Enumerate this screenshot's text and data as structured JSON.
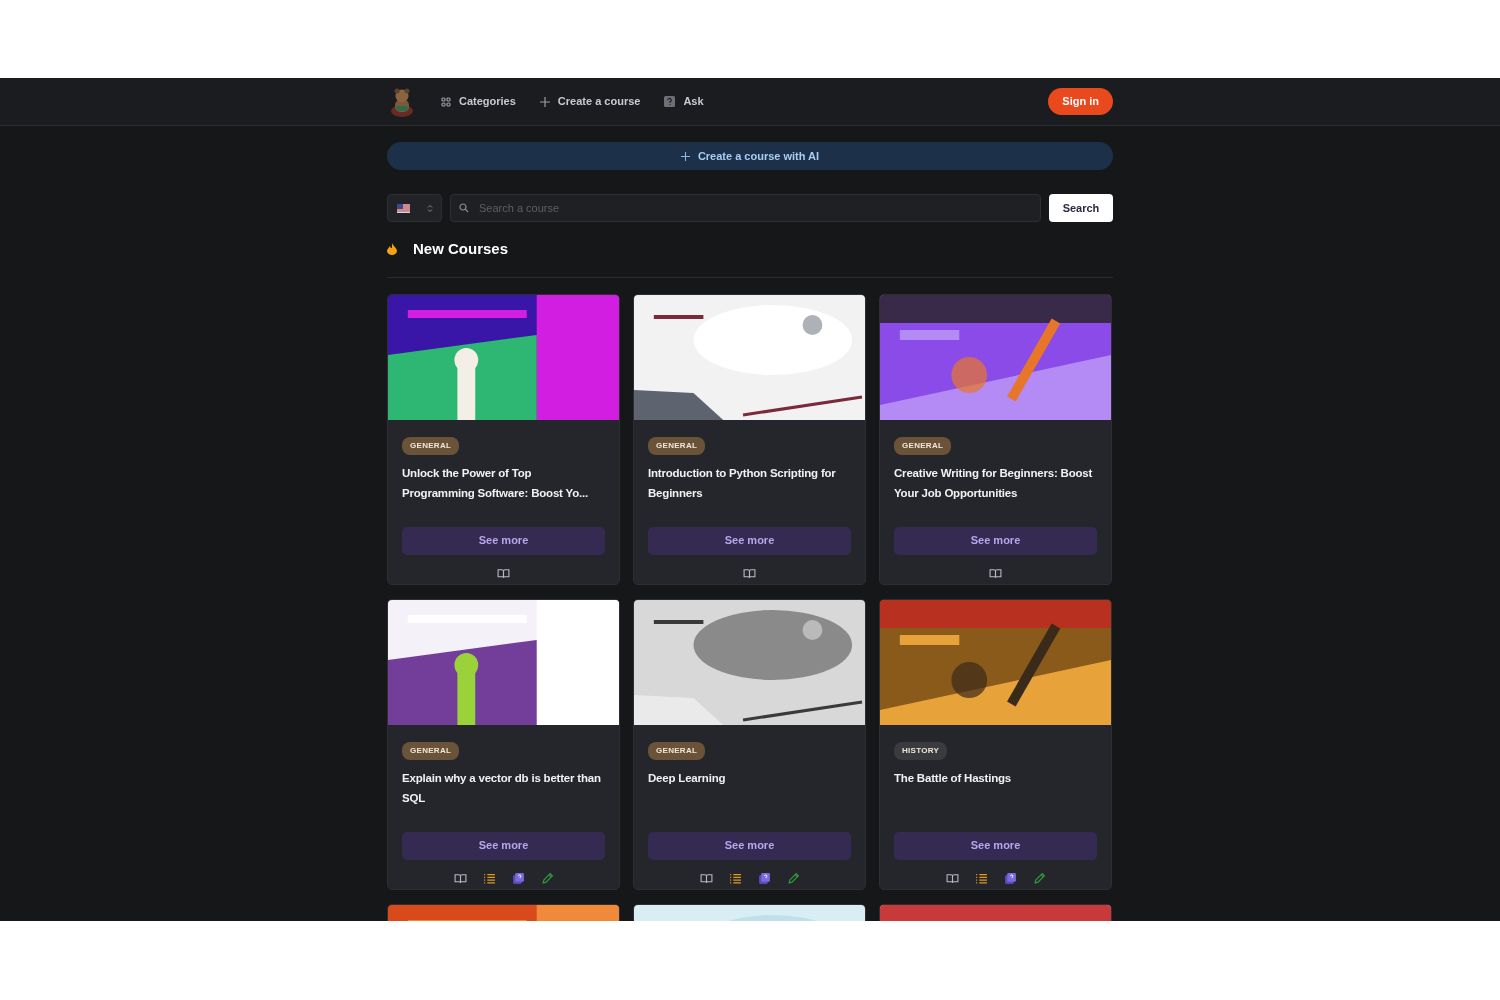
{
  "navbar": {
    "links": [
      {
        "kind": "categories",
        "label": "Categories"
      },
      {
        "kind": "create",
        "label": "Create a course"
      },
      {
        "kind": "ask",
        "label": "Ask"
      }
    ],
    "sign_in": "Sign in"
  },
  "ai_button": "Create a course with AI",
  "search": {
    "placeholder": "Search a course",
    "button": "Search"
  },
  "section_title": "New Courses",
  "cards": [
    {
      "category": "GENERAL",
      "color": "#6b5339",
      "title": "Unlock the Power of Top Programming Software: Boost Yo...",
      "button": "See more",
      "tools": [
        {
          "kind": "read"
        }
      ]
    },
    {
      "category": "GENERAL",
      "color": "#6b5339",
      "title": "Introduction to Python Scripting for Beginners",
      "button": "See more",
      "tools": [
        {
          "kind": "read"
        }
      ]
    },
    {
      "category": "GENERAL",
      "color": "#6b5339",
      "title": "Creative Writing for Beginners: Boost Your Job Opportunities",
      "button": "See more",
      "tools": [
        {
          "kind": "read"
        }
      ]
    },
    {
      "category": "GENERAL",
      "color": "#6b5339",
      "title": "Explain why a vector db is better than SQL",
      "button": "See more",
      "tools": [
        {
          "kind": "read"
        },
        {
          "kind": "outline"
        },
        {
          "kind": "quiz"
        },
        {
          "kind": "edit"
        }
      ]
    },
    {
      "category": "GENERAL",
      "color": "#6b5339",
      "title": "Deep Learning",
      "button": "See more",
      "tools": [
        {
          "kind": "read"
        },
        {
          "kind": "outline"
        },
        {
          "kind": "quiz"
        },
        {
          "kind": "edit"
        }
      ]
    },
    {
      "category": "HISTORY",
      "color": "#3a3b3e",
      "title": "The Battle of Hastings",
      "button": "See more",
      "tools": [
        {
          "kind": "read"
        },
        {
          "kind": "outline"
        },
        {
          "kind": "quiz"
        },
        {
          "kind": "edit"
        }
      ]
    },
    {
      "kind": "picture"
    },
    {
      "kind": "picture"
    },
    {
      "kind": "picture"
    }
  ]
}
